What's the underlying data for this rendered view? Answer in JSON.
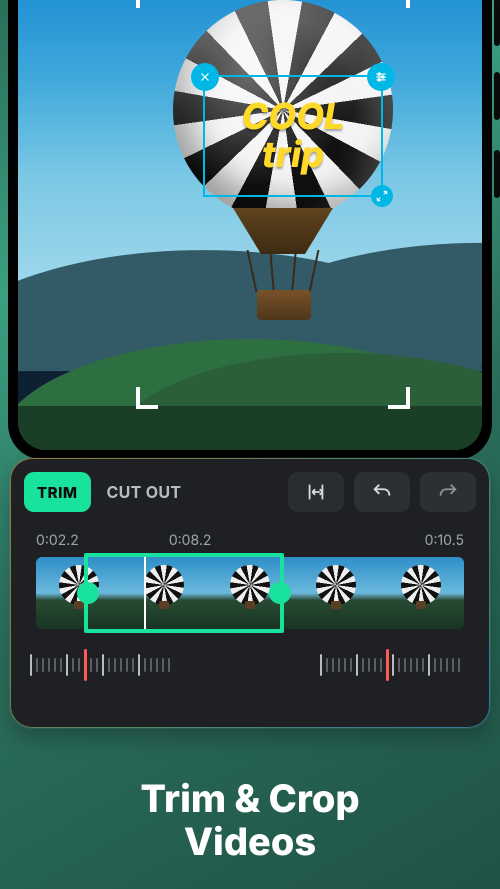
{
  "overlay_text": {
    "line1": "COOL",
    "line2": "trip"
  },
  "toolbar": {
    "trim": "TRIM",
    "cutout": "CUT OUT"
  },
  "times": {
    "start": "0:02.2",
    "mid": "0:08.2",
    "end": "0:10.5"
  },
  "caption": {
    "line1": "Trim & Crop",
    "line2": "Videos"
  },
  "chip_icons": {
    "close": "close-icon",
    "adjust": "sliders-icon",
    "resize": "expand-icon"
  }
}
